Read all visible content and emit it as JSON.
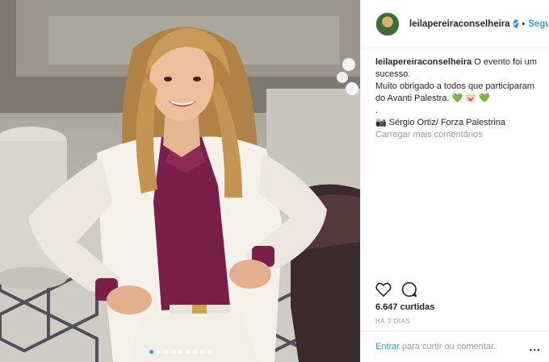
{
  "post": {
    "username": "leilapereiraconselheira",
    "verified_mark": "✔",
    "separator": "•",
    "follow_label": "Seguir"
  },
  "caption": {
    "username": "leilapereiraconselheira",
    "line1": "O evento foi um sucesso.",
    "line2": "Muito obrigado a todos que participaram do Avanti Palestra.",
    "emoji_heart_green_1": "💚",
    "emoji_face": "🐷",
    "emoji_heart_green_2": "💚",
    "dot_line": ".",
    "camera_emoji": "📷",
    "credit": "Sérgio Ortiz/ Forza Palestrina"
  },
  "load_more_comments": "Carregar mais comentários",
  "likes_text": "6.647 curtidas",
  "time_ago": "HÁ 3 DIAS",
  "comment_prompt": {
    "enter_label": "Entrar",
    "rest_text": "para curtir ou comentar.",
    "options_label": "..."
  },
  "icons": {
    "heart": "heart-icon",
    "comment": "comment-icon",
    "avatar": "avatar"
  },
  "colors": {
    "accent_blue": "#3897f0",
    "muted_gray": "#999999",
    "text_dark": "#262626"
  },
  "carousel": {
    "count": 9,
    "active_index": 0
  }
}
